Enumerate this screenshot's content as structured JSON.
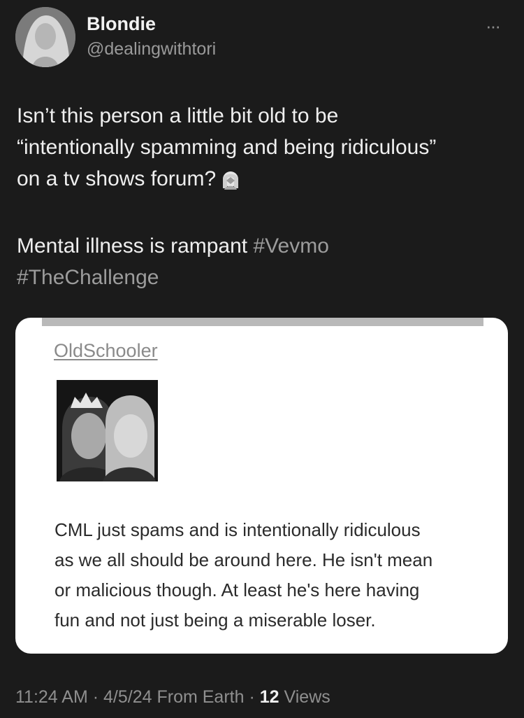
{
  "tweet": {
    "author": {
      "display_name": "Blondie",
      "handle": "@dealingwithtori",
      "avatar_icon": "profile-photo"
    },
    "more_icon": "ellipsis-icon",
    "more_label": "···",
    "text_lines": [
      "Isn’t this person a little bit old to be",
      "“intentionally spamming and being ridiculous”",
      "on a tv shows forum?"
    ],
    "emoji_icon": "woman-facepalming-emoji",
    "text2": "Mental illness is rampant",
    "hashtags": [
      "#Vevmo",
      "#TheChallenge"
    ],
    "meta": {
      "time": "11:24 AM",
      "date": "4/5/24",
      "source": "From Earth",
      "sep": "·",
      "views_count": "12",
      "views_label": "Views"
    }
  },
  "embedded_post": {
    "username": "OldSchooler",
    "image_icon": "two-women-photo",
    "body_lines": [
      "CML just spams and is intentionally ridiculous",
      "as we all should be around here. He isn't mean",
      "or malicious though. At least he's here having",
      "fun and not just being a miserable loser."
    ]
  }
}
